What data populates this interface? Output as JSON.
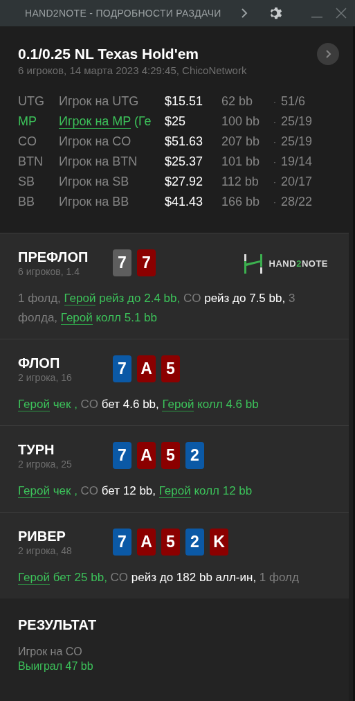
{
  "window": {
    "title": "HAND2NOTE - ПОДРОБНОСТИ РАЗДАЧИ"
  },
  "hand": {
    "title": "0.1/0.25 NL Texas Hold'em",
    "meta": "6 игроков, 14 марта 2023 4:29:45, ChicoNetwork"
  },
  "players": [
    {
      "position": "UTG",
      "name": "Игрок на UTG",
      "hero": false,
      "stack": "$15.51",
      "bb": "62 bb",
      "separator": "·",
      "stats": "51/6"
    },
    {
      "position": "MP",
      "name": "Игрок на MP",
      "note": "(Ге",
      "hero": true,
      "stack": "$25",
      "bb": "100 bb",
      "separator": "·",
      "stats": "25/19"
    },
    {
      "position": "CO",
      "name": "Игрок на CO",
      "hero": false,
      "stack": "$51.63",
      "bb": "207 bb",
      "separator": "·",
      "stats": "25/19"
    },
    {
      "position": "BTN",
      "name": "Игрок на BTN",
      "hero": false,
      "stack": "$25.37",
      "bb": "101 bb",
      "separator": "·",
      "stats": "19/14"
    },
    {
      "position": "SB",
      "name": "Игрок на SB",
      "hero": false,
      "stack": "$27.92",
      "bb": "112 bb",
      "separator": "·",
      "stats": "20/17"
    },
    {
      "position": "BB",
      "name": "Игрок на BB",
      "hero": false,
      "stack": "$41.43",
      "bb": "166 bb",
      "separator": "·",
      "stats": "28/22"
    }
  ],
  "streets": [
    {
      "title": "ПРЕФЛОП",
      "meta": "6 игроков, 1.4",
      "logo": {
        "prefix": "HAND",
        "accent": "2",
        "suffix": "NOTE"
      },
      "cards": [
        {
          "rank": "7",
          "color": "#5e5e5e"
        },
        {
          "rank": "7",
          "color": "#8b0000"
        }
      ],
      "actions": [
        {
          "kind": "muted",
          "text": "1 фолд, "
        },
        {
          "kind": "hero",
          "text": "Герой"
        },
        {
          "kind": "green",
          "text": " рейз до 2.4 bb, "
        },
        {
          "kind": "muted",
          "text": "CO "
        },
        {
          "kind": "white",
          "text": "рейз до 7.5 bb, "
        },
        {
          "kind": "muted",
          "text": "3 фолда, "
        },
        {
          "kind": "hero",
          "text": "Герой"
        },
        {
          "kind": "green",
          "text": " колл 5.1 bb"
        }
      ]
    },
    {
      "title": "ФЛОП",
      "meta": "2 игрока, 16",
      "cards": [
        {
          "rank": "7",
          "color": "#0b59a6"
        },
        {
          "rank": "A",
          "color": "#8b0000"
        },
        {
          "rank": "5",
          "color": "#8b0000"
        }
      ],
      "actions": [
        {
          "kind": "hero",
          "text": "Герой"
        },
        {
          "kind": "green",
          "text": " чек , "
        },
        {
          "kind": "muted",
          "text": "CO "
        },
        {
          "kind": "white",
          "text": "бет 4.6 bb, "
        },
        {
          "kind": "hero",
          "text": "Герой"
        },
        {
          "kind": "green",
          "text": " колл 4.6 bb"
        }
      ]
    },
    {
      "title": "ТУРН",
      "meta": "2 игрока, 25",
      "cards": [
        {
          "rank": "7",
          "color": "#0b59a6"
        },
        {
          "rank": "A",
          "color": "#8b0000"
        },
        {
          "rank": "5",
          "color": "#8b0000"
        },
        {
          "rank": "2",
          "color": "#0b59a6"
        }
      ],
      "actions": [
        {
          "kind": "hero",
          "text": "Герой"
        },
        {
          "kind": "green",
          "text": " чек , "
        },
        {
          "kind": "muted",
          "text": "CO "
        },
        {
          "kind": "white",
          "text": "бет 12 bb, "
        },
        {
          "kind": "hero",
          "text": "Герой"
        },
        {
          "kind": "green",
          "text": " колл 12 bb"
        }
      ]
    },
    {
      "title": "РИВЕР",
      "meta": "2 игрока, 48",
      "cards": [
        {
          "rank": "7",
          "color": "#0b59a6"
        },
        {
          "rank": "A",
          "color": "#8b0000"
        },
        {
          "rank": "5",
          "color": "#8b0000"
        },
        {
          "rank": "2",
          "color": "#0b59a6"
        },
        {
          "rank": "K",
          "color": "#8b0000"
        }
      ],
      "actions": [
        {
          "kind": "hero",
          "text": "Герой"
        },
        {
          "kind": "green",
          "text": " бет 25 bb, "
        },
        {
          "kind": "muted",
          "text": "CO "
        },
        {
          "kind": "white",
          "text": "рейз до 182 bb алл-ин, "
        },
        {
          "kind": "muted",
          "text": "1 фолд"
        }
      ]
    }
  ],
  "result": {
    "title": "РЕЗУЛЬТАТ",
    "winner": "Игрок на CO",
    "amount": "Выиграл 47 bb"
  }
}
